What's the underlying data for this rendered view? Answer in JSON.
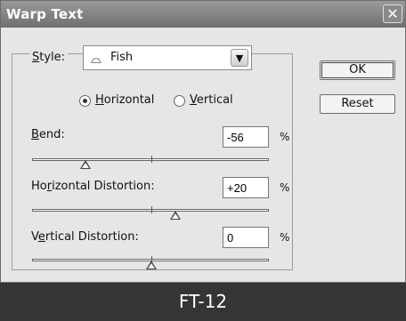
{
  "window": {
    "title": "Warp Text"
  },
  "style": {
    "label": "Style:",
    "value": "Fish",
    "icon": "fish-icon"
  },
  "orientation": {
    "horizontal_label": "Horizontal",
    "vertical_label": "Vertical",
    "selected": "Horizontal"
  },
  "bend": {
    "label": "Bend:",
    "value": "-56",
    "unit": "%",
    "level_percent": -56
  },
  "horizontal_distortion": {
    "label": "Horizontal Distortion:",
    "value": "+20",
    "unit": "%",
    "level_percent": 20
  },
  "vertical_distortion": {
    "label": "Vertical Distortion:",
    "value": "0",
    "unit": "%",
    "level_percent": 0
  },
  "buttons": {
    "ok": "OK",
    "reset": "Reset"
  },
  "footer": {
    "caption": "FT-12"
  }
}
